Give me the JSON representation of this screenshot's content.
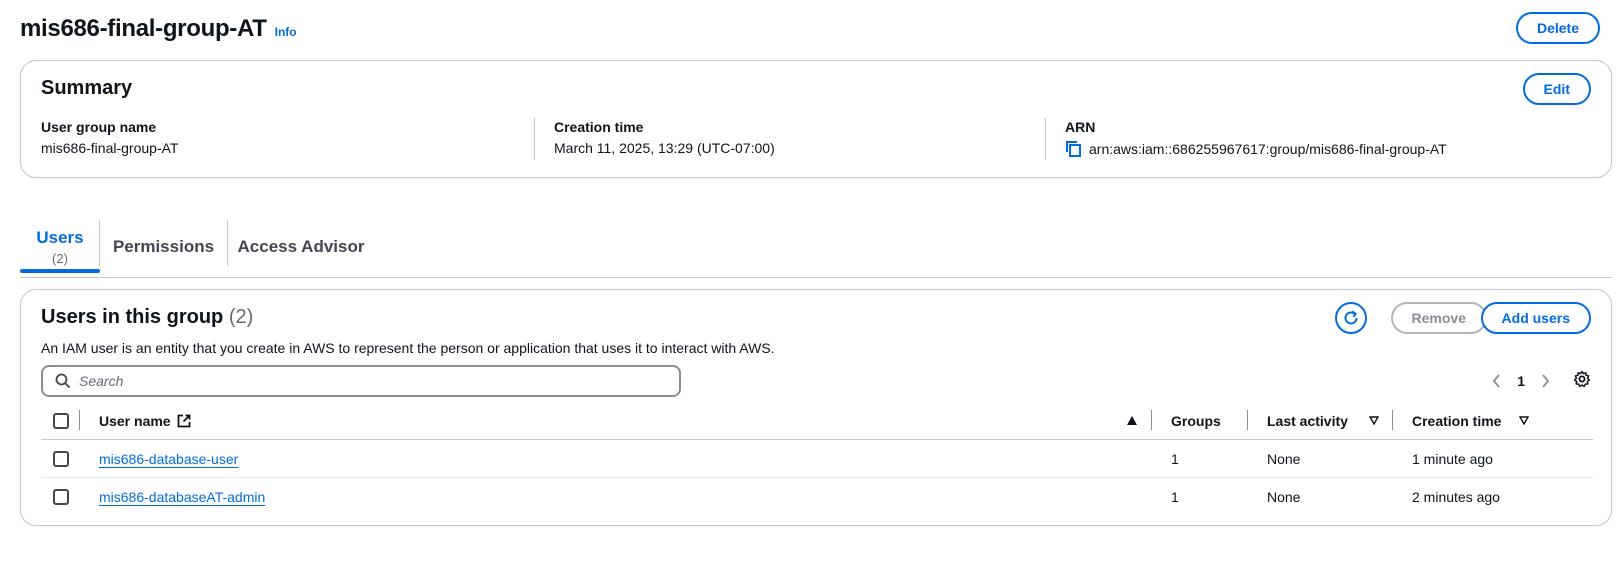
{
  "header": {
    "title": "mis686-final-group-AT",
    "info": "Info",
    "delete_label": "Delete"
  },
  "summary": {
    "title": "Summary",
    "edit_label": "Edit",
    "fields": [
      {
        "label": "User group name",
        "value": "mis686-final-group-AT"
      },
      {
        "label": "Creation time",
        "value": "March 11, 2025, 13:29 (UTC-07:00)"
      },
      {
        "label": "ARN",
        "value": "arn:aws:iam::686255967617:group/mis686-final-group-AT"
      }
    ]
  },
  "tabs": [
    {
      "label": "Users",
      "count": "(2)",
      "active": true
    },
    {
      "label": "Permissions"
    },
    {
      "label": "Access Advisor"
    }
  ],
  "users_panel": {
    "title": "Users in this group",
    "count": "(2)",
    "description": "An IAM user is an entity that you create in AWS to represent the person or application that uses it to interact with AWS.",
    "remove_label": "Remove",
    "add_label": "Add users",
    "search_placeholder": "Search",
    "page": "1",
    "columns": [
      "User name",
      "Groups",
      "Last activity",
      "Creation time"
    ],
    "rows": [
      {
        "user_name": "mis686-database-user",
        "groups": "1",
        "last_activity": "None",
        "creation_time": "1 minute ago"
      },
      {
        "user_name": "mis686-databaseAT-admin",
        "groups": "1",
        "last_activity": "None",
        "creation_time": "2 minutes ago"
      }
    ]
  },
  "colors": {
    "accent": "#006ce0",
    "border": "#c6c6cd",
    "text": "#0f141a",
    "muted": "#656871"
  }
}
